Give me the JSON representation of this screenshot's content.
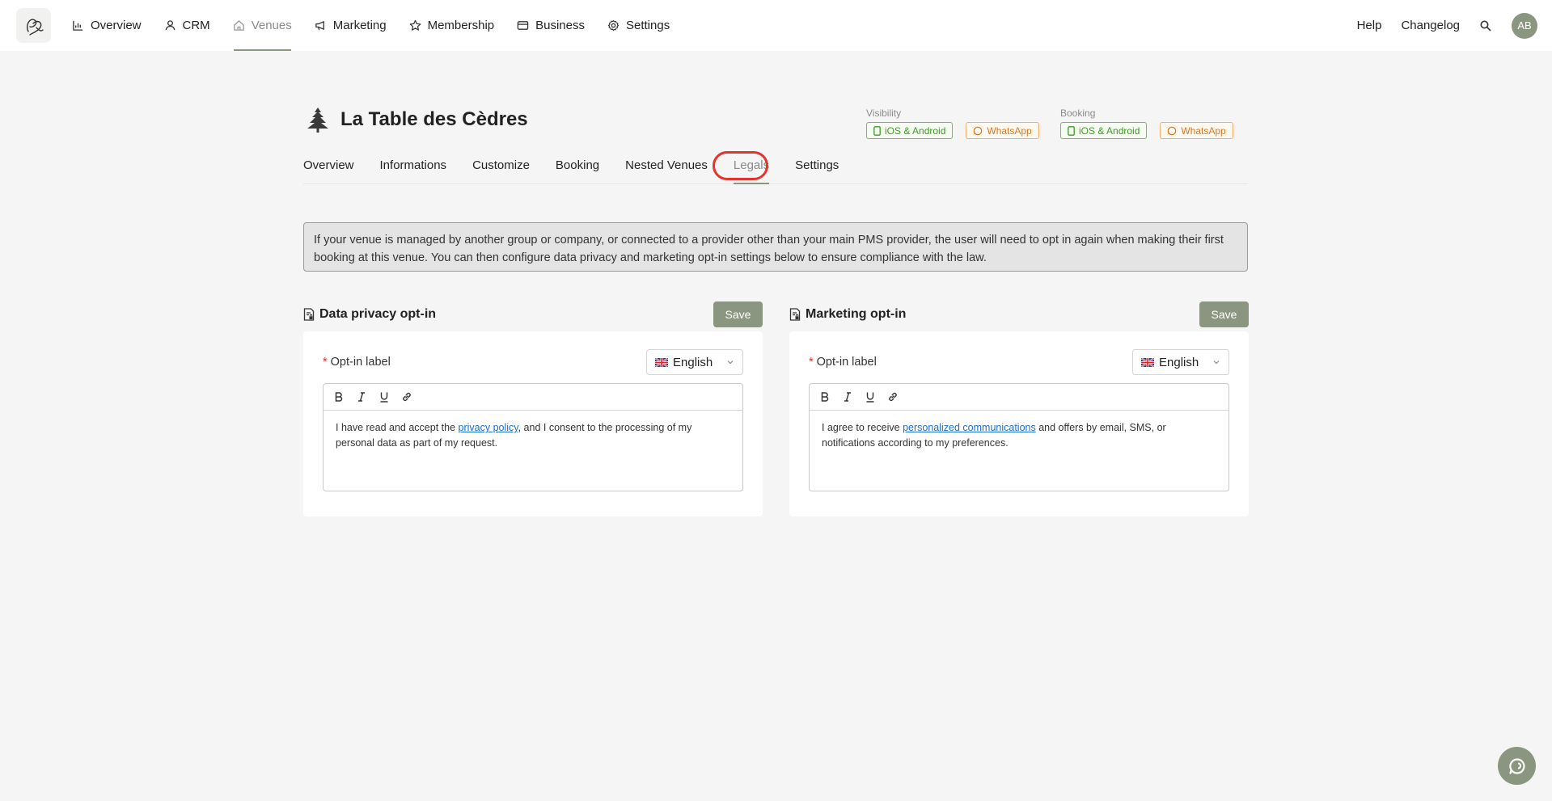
{
  "nav": {
    "items": [
      {
        "label": "Overview",
        "icon": "chart-icon"
      },
      {
        "label": "CRM",
        "icon": "user-icon"
      },
      {
        "label": "Venues",
        "icon": "home-icon",
        "active": true
      },
      {
        "label": "Marketing",
        "icon": "megaphone-icon"
      },
      {
        "label": "Membership",
        "icon": "star-icon"
      },
      {
        "label": "Business",
        "icon": "wallet-icon"
      },
      {
        "label": "Settings",
        "icon": "gear-icon"
      }
    ],
    "help": "Help",
    "changelog": "Changelog",
    "avatar_initials": "AB"
  },
  "venue": {
    "title": "La Table des Cèdres",
    "visibility_title": "Visibility",
    "booking_title": "Booking",
    "visibility": [
      "iOS & Android",
      "WhatsApp"
    ],
    "booking": [
      "iOS & Android",
      "WhatsApp"
    ]
  },
  "subtabs": [
    "Overview",
    "Informations",
    "Customize",
    "Booking",
    "Nested Venues",
    "Legals",
    "Settings"
  ],
  "notice": "If your venue is managed by another group or company, or connected to a provider other than your main PMS provider, the user will need to opt in again when making their first booking at this venue. You can then configure data privacy and marketing opt-in settings below to ensure compliance with the law.",
  "privacy": {
    "title": "Data privacy opt-in",
    "save": "Save",
    "label": "Opt-in label",
    "required_mark": "*",
    "language": "English",
    "text_before": "I have read and accept the ",
    "link": "privacy policy",
    "text_after": ", and I consent to the processing of my personal data as part of my request."
  },
  "marketing": {
    "title": "Marketing opt-in",
    "save": "Save",
    "label": "Opt-in label",
    "required_mark": "*",
    "language": "English",
    "text_before": "I agree to receive ",
    "link": "personalized communications",
    "text_after": " and offers by email, SMS, or notifications according to my preferences."
  },
  "colors": {
    "accent": "#8b9680",
    "highlight": "#e2332d",
    "green": "#3e9a26",
    "orange": "#d7781c",
    "link": "#1a6fd1"
  }
}
